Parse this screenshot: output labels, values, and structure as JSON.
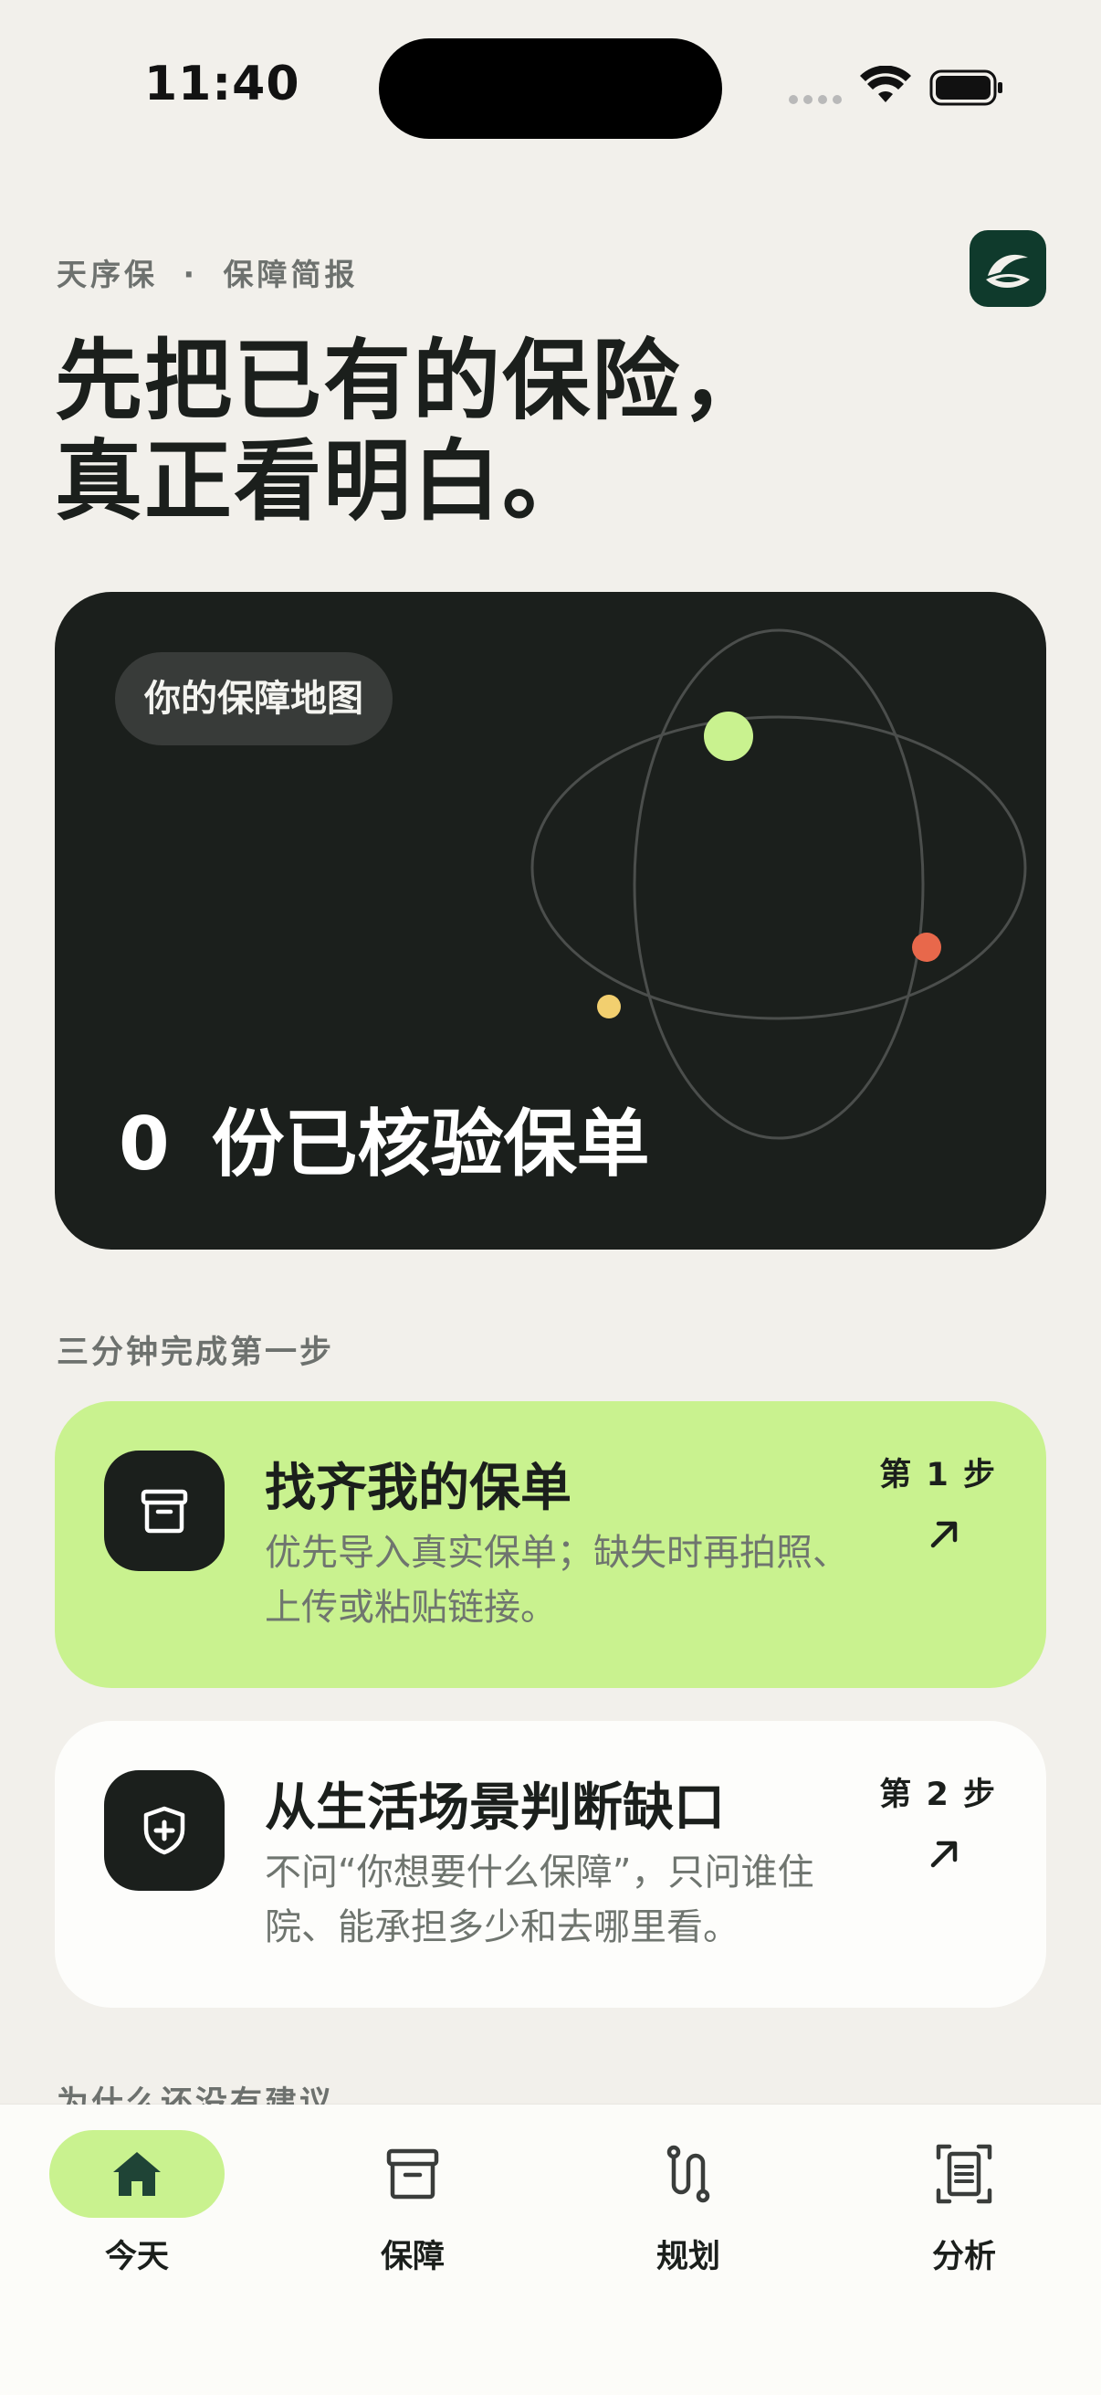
{
  "status_bar": {
    "time": "11:40"
  },
  "header": {
    "brand": "天序保",
    "separator": "·",
    "section": "保障简报",
    "headline_line1": "先把已有的保险，",
    "headline_line2": "真正看明白。",
    "logo_icon": "app-logo-icon"
  },
  "map_card": {
    "chip_label": "你的保障地图",
    "verified_count": "0",
    "verified_label": "份已核验保单",
    "colors": {
      "background": "#1b1f1c",
      "dot_green": "#c9f28f",
      "dot_red": "#e8684b",
      "dot_yellow": "#f2cf6f"
    }
  },
  "steps_section": {
    "label": "三分钟完成第一步",
    "steps": [
      {
        "title": "找齐我的保单",
        "description": "优先导入真实保单；缺失时再拍照、上传或粘贴链接。",
        "step_label": "第 1 步",
        "icon": "archive-box-icon",
        "background": "#c9f28f"
      },
      {
        "title": "从生活场景判断缺口",
        "description": "不问“你想要什么保障”，只问谁住院、能承担多少和去哪里看。",
        "step_label": "第 2 步",
        "icon": "shield-plus-icon",
        "background": "#fdfdfb"
      }
    ]
  },
  "peek_section": {
    "label": "为什么还没有建议"
  },
  "tab_bar": {
    "tabs": [
      {
        "label": "今天",
        "icon": "home-icon",
        "active": true
      },
      {
        "label": "保障",
        "icon": "archive-box-icon",
        "active": false
      },
      {
        "label": "规划",
        "icon": "route-icon",
        "active": false
      },
      {
        "label": "分析",
        "icon": "document-scan-icon",
        "active": false
      }
    ],
    "accent": "#c9f28f"
  }
}
